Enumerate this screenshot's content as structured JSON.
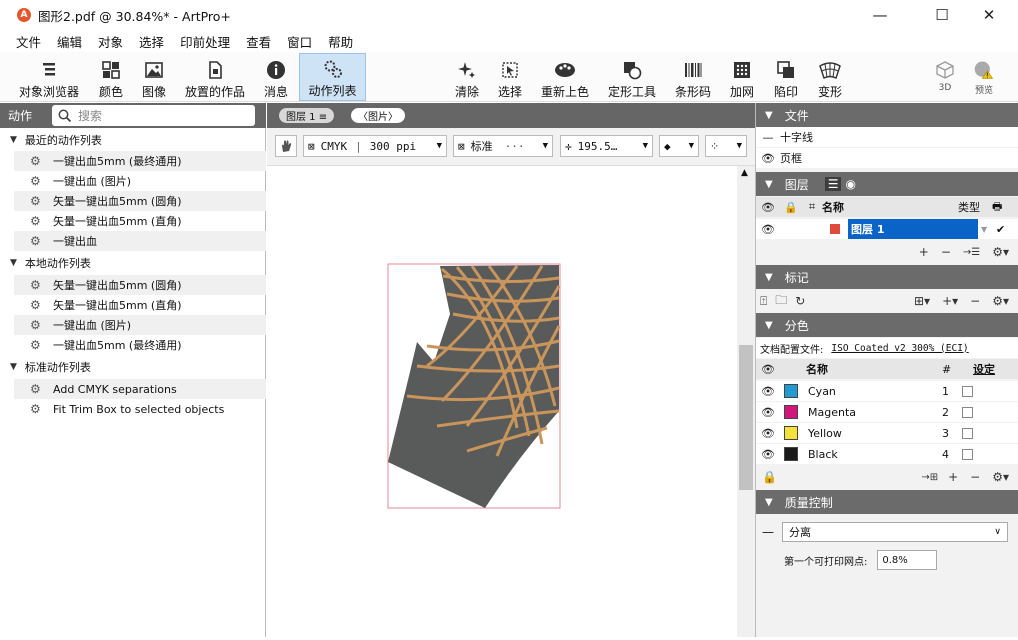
{
  "window": {
    "title": "图形2.pdf @ 30.84%* - ArtPro+",
    "minimize": "—",
    "maximize": "☐",
    "close": "✕"
  },
  "menu": [
    "文件",
    "编辑",
    "对象",
    "选择",
    "印前处理",
    "查看",
    "窗口",
    "帮助"
  ],
  "toolbar": {
    "object_browser": "对象浏览器",
    "colors": "颜色",
    "images": "图像",
    "placed_art": "放置的作品",
    "messages": "消息",
    "action_list": "动作列表",
    "clear": "清除",
    "select": "选择",
    "recolor": "重新上色",
    "shape_tool": "定形工具",
    "barcode": "条形码",
    "screening": "加网",
    "trapping": "陷印",
    "distort": "变形",
    "view3d": "3D",
    "preview": "预览"
  },
  "left_panel": {
    "header": "动作",
    "search_placeholder": "搜索",
    "groups": [
      {
        "title": "最近的动作列表",
        "items": [
          "一键出血5mm (最终通用)",
          "一键出血 (图片)",
          "矢量一键出血5mm (圆角)",
          "矢量一键出血5mm (直角)",
          "一键出血"
        ]
      },
      {
        "title": "本地动作列表",
        "items": [
          "矢量一键出血5mm (圆角)",
          "矢量一键出血5mm (直角)",
          "一键出血 (图片)",
          "一键出血5mm (最终通用)"
        ]
      },
      {
        "title": "标准动作列表",
        "items": [
          "Add CMYK separations",
          "Fit Trim Box to selected objects"
        ]
      }
    ]
  },
  "document": {
    "layer_pill": "图层 1 ≡",
    "image_pill": "〈图片〉",
    "color_mode": "CMYK",
    "resolution": "300 ppi",
    "quality": "标准",
    "zoom": "195.5…",
    "colors": {
      "shape_fill": "#595b5a",
      "lines": "#c9955b",
      "trim_box": "#e08a95"
    }
  },
  "right_panel": {
    "file": {
      "title": "文件",
      "crosshair": "十字线",
      "page_frame": "页框"
    },
    "layers": {
      "title": "图层",
      "col_name": "名称",
      "col_type": "类型",
      "layer_name": "图层 1"
    },
    "marks": {
      "title": "标记"
    },
    "separations": {
      "title": "分色",
      "profile_label": "文档配置文件:",
      "profile_value": "ISO Coated v2 300% (ECI)",
      "col_name": "名称",
      "col_num": "#",
      "col_setting": "设定",
      "inks": [
        {
          "name": "Cyan",
          "num": "1",
          "color": "#1f9bd1"
        },
        {
          "name": "Magenta",
          "num": "2",
          "color": "#d1177e"
        },
        {
          "name": "Yellow",
          "num": "3",
          "color": "#f4e23a"
        },
        {
          "name": "Black",
          "num": "4",
          "color": "#1a1a1a"
        }
      ]
    },
    "quality": {
      "title": "质量控制",
      "mode": "分离",
      "min_dot_label": "第一个可打印网点:",
      "min_dot_value": "0.8%"
    }
  }
}
